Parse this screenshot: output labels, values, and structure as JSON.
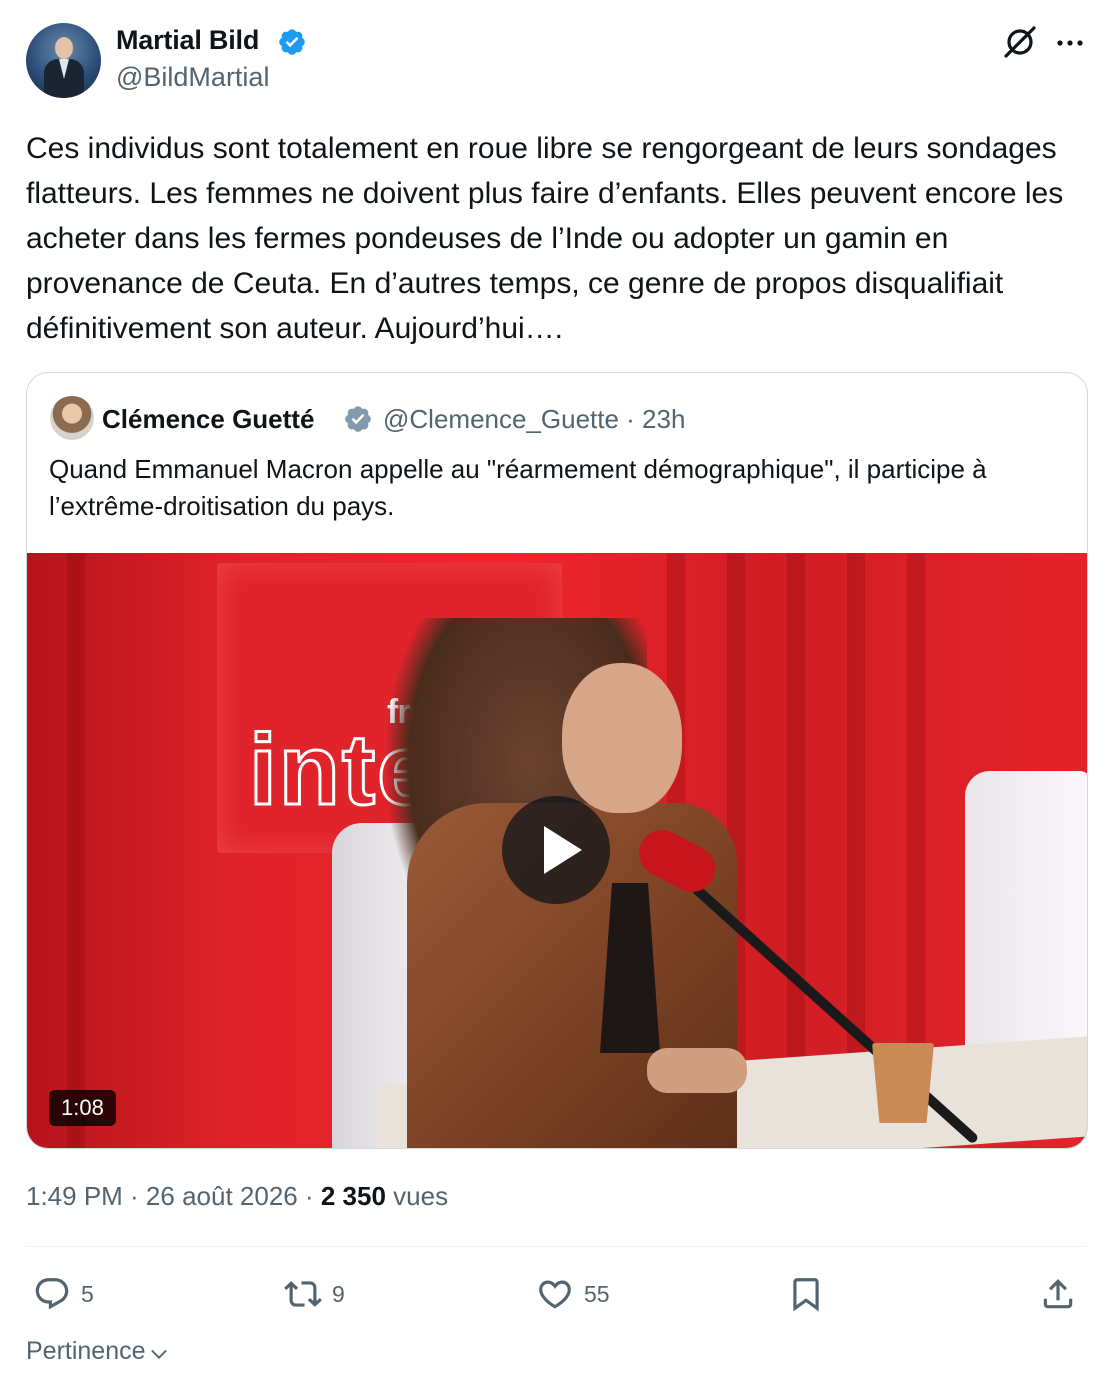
{
  "tweet": {
    "author_name": "Martial Bild",
    "author_handle": "@BildMartial",
    "text": "Ces individus sont totalement en roue libre se rengorgeant de leurs sondages flatteurs. Les femmes ne doivent plus faire d’enfants. Elles peuvent encore les acheter dans les fermes pondeuses de l’Inde ou adopter un gamin en provenance de Ceuta. En d’autres temps, ce genre de propos disqualifiait définitivement son auteur. Aujourd’hui…."
  },
  "quote": {
    "author_name": "Clémence Guetté",
    "author_handle": "@Clemence_Guette · 23h",
    "text": "Quand Emmanuel Macron appelle au \"réarmement démographique\", il participe à l’extrême-droitisation du pays.",
    "video": {
      "brand_top": "france",
      "brand_main": "inter",
      "duration": "1:08"
    }
  },
  "meta": {
    "time_date": "1:49 PM · 26 août 2026 · ",
    "views_count": "2 350",
    "views_label": " vues"
  },
  "actions": {
    "replies": "5",
    "reposts": "9",
    "likes": "55"
  },
  "sort": {
    "label": "Pertinence"
  },
  "colors": {
    "verified_blue": "#1d9bf0",
    "verified_gray": "#829aab",
    "secondary_text": "#536471",
    "primary_text": "#0f1419"
  },
  "icons": [
    "verified-badge-icon",
    "grok-icon",
    "more-icon",
    "play-icon",
    "reply-icon",
    "repost-icon",
    "like-icon",
    "bookmark-icon",
    "share-icon",
    "chevron-down-icon"
  ]
}
